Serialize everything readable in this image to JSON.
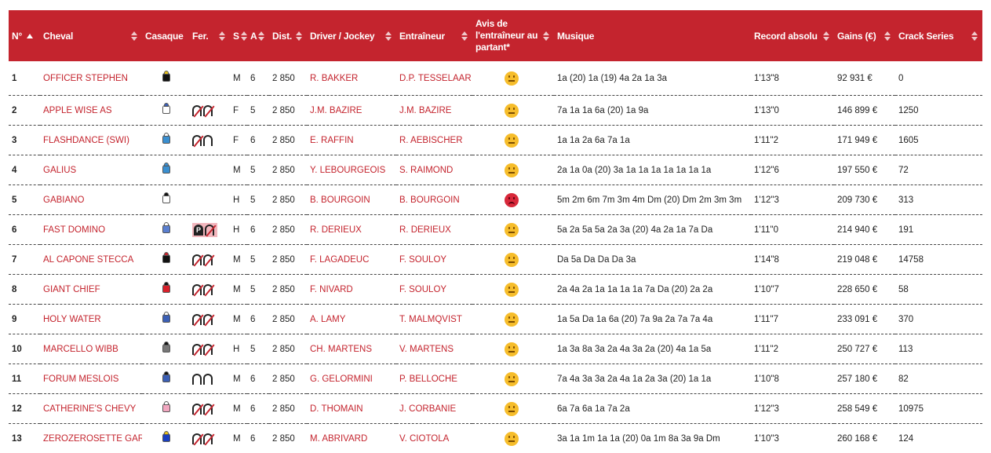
{
  "headers": {
    "num": "N°",
    "cheval": "Cheval",
    "casaque": "Casaque",
    "fer": "Fer.",
    "s": "S",
    "a": "A",
    "dist": "Dist.",
    "driver": "Driver / Jockey",
    "entraineur": "Entraîneur",
    "avis": "Avis de l'entraîneur au partant*",
    "musique": "Musique",
    "record": "Record absolu",
    "gains": "Gains (€)",
    "crack": "Crack Series"
  },
  "colors": {
    "accent": "#c4242e",
    "smiley_neutral": "#f6bd2b",
    "smiley_sad": "#d8283a"
  },
  "rows": [
    {
      "num": "1",
      "cheval": "OFFICER STEPHEN",
      "jersey": {
        "body": "#111111",
        "cap": "#e8c21a"
      },
      "fer": "none",
      "s": "M",
      "a": "6",
      "dist": "2 850",
      "driver": "R. BAKKER",
      "entraineur": "D.P. TESSELAAR",
      "avis": "neutral",
      "musique": "1a (20) 1a (19) 4a 2a 1a 3a",
      "record": "1'13\"8",
      "gains": "92 931 €",
      "crack": "0"
    },
    {
      "num": "2",
      "cheval": "APPLE WISE AS",
      "jersey": {
        "body": "#ffffff",
        "cap": "#3b5fb5"
      },
      "fer": "xx",
      "s": "F",
      "a": "5",
      "dist": "2 850",
      "driver": "J.M. BAZIRE",
      "entraineur": "J.M. BAZIRE",
      "avis": "neutral",
      "musique": "7a 1a 1a 6a (20) 1a 9a",
      "record": "1'13\"0",
      "gains": "146 899 €",
      "crack": "1250"
    },
    {
      "num": "3",
      "cheval": "FLASHDANCE (SWI)",
      "jersey": {
        "body": "#3a8fd0",
        "cap": "#ffffff"
      },
      "fer": "xo",
      "s": "F",
      "a": "6",
      "dist": "2 850",
      "driver": "E. RAFFIN",
      "entraineur": "R. AEBISCHER",
      "avis": "neutral",
      "musique": "1a 1a 2a 6a 7a 1a",
      "record": "1'11\"2",
      "gains": "171 949 €",
      "crack": "1605"
    },
    {
      "num": "4",
      "cheval": "GALIUS",
      "jersey": {
        "body": "#3a8fd0",
        "cap": "#3a8fd0"
      },
      "fer": "none",
      "s": "M",
      "a": "5",
      "dist": "2 850",
      "driver": "Y. LEBOURGEOIS",
      "entraineur": "S. RAIMOND",
      "avis": "neutral",
      "musique": "2a 1a 0a (20) 3a 1a 1a 1a 1a 1a 1a 1a",
      "record": "1'12\"6",
      "gains": "197 550 €",
      "crack": "72"
    },
    {
      "num": "5",
      "cheval": "GABIANO",
      "jersey": {
        "body": "#ffffff",
        "cap": "#111111"
      },
      "fer": "none",
      "s": "H",
      "a": "5",
      "dist": "2 850",
      "driver": "B. BOURGOIN",
      "entraineur": "B. BOURGOIN",
      "avis": "sad",
      "musique": "5m 2m 6m 7m 3m 4m Dm (20) Dm 2m 3m 3m",
      "record": "1'12\"3",
      "gains": "209 730 €",
      "crack": "313"
    },
    {
      "num": "6",
      "cheval": "FAST DOMINO",
      "jersey": {
        "body": "#5a7fd0",
        "cap": "#ffffff"
      },
      "fer": "p",
      "s": "H",
      "a": "6",
      "dist": "2 850",
      "driver": "R. DERIEUX",
      "entraineur": "R. DERIEUX",
      "avis": "neutral",
      "musique": "5a 2a 5a 5a 2a 3a (20) 4a 2a 1a 7a Da",
      "record": "1'11\"0",
      "gains": "214 940 €",
      "crack": "191"
    },
    {
      "num": "7",
      "cheval": "AL CAPONE STECCA",
      "jersey": {
        "body": "#111111",
        "cap": "#c4242e"
      },
      "fer": "xx",
      "s": "M",
      "a": "5",
      "dist": "2 850",
      "driver": "F. LAGADEUC",
      "entraineur": "F. SOULOY",
      "avis": "neutral",
      "musique": "Da 5a Da Da Da 3a",
      "record": "1'14\"8",
      "gains": "219 048 €",
      "crack": "14758"
    },
    {
      "num": "8",
      "cheval": "GIANT CHIEF",
      "jersey": {
        "body": "#d8202a",
        "cap": "#111111"
      },
      "fer": "xx",
      "s": "M",
      "a": "5",
      "dist": "2 850",
      "driver": "F. NIVARD",
      "entraineur": "F. SOULOY",
      "avis": "neutral",
      "musique": "2a 4a 2a 1a 1a 1a 1a 7a Da (20) 2a 2a",
      "record": "1'10\"7",
      "gains": "228 650 €",
      "crack": "58"
    },
    {
      "num": "9",
      "cheval": "HOLY WATER",
      "jersey": {
        "body": "#3b5fb5",
        "cap": "#ffffff"
      },
      "fer": "xx",
      "s": "M",
      "a": "6",
      "dist": "2 850",
      "driver": "A. LAMY",
      "entraineur": "T. MALMQVIST",
      "avis": "neutral",
      "musique": "1a 5a Da 1a 6a (20) 7a 9a 2a 7a 7a 4a",
      "record": "1'11\"7",
      "gains": "233 091 €",
      "crack": "370"
    },
    {
      "num": "10",
      "cheval": "MARCELLO WIBB",
      "jersey": {
        "body": "#777777",
        "cap": "#111111"
      },
      "fer": "xx",
      "s": "H",
      "a": "5",
      "dist": "2 850",
      "driver": "CH. MARTENS",
      "entraineur": "V. MARTENS",
      "avis": "neutral",
      "musique": "1a 3a 8a 3a 2a 4a 3a 2a (20) 4a 1a 5a",
      "record": "1'11\"2",
      "gains": "250 727 €",
      "crack": "113"
    },
    {
      "num": "11",
      "cheval": "FORUM MESLOIS",
      "jersey": {
        "body": "#3b5fb5",
        "cap": "#111111"
      },
      "fer": "oo",
      "s": "M",
      "a": "6",
      "dist": "2 850",
      "driver": "G. GELORMINI",
      "entraineur": "P. BELLOCHE",
      "avis": "neutral",
      "musique": "7a 4a 3a 3a 2a 4a 1a 2a 3a (20) 1a 1a",
      "record": "1'10\"8",
      "gains": "257 180 €",
      "crack": "82"
    },
    {
      "num": "12",
      "cheval": "CATHERINE'S CHEVY",
      "jersey": {
        "body": "#f2a7c0",
        "cap": "#ffffff"
      },
      "fer": "xx",
      "s": "M",
      "a": "6",
      "dist": "2 850",
      "driver": "D. THOMAIN",
      "entraineur": "J. CORBANIE",
      "avis": "neutral",
      "musique": "6a 7a 6a 1a 7a 2a",
      "record": "1'12\"3",
      "gains": "258 549 €",
      "crack": "10975"
    },
    {
      "num": "13",
      "cheval": "ZEROZEROSETTE GAR",
      "jersey": {
        "body": "#1a3fc0",
        "cap": "#e8c21a"
      },
      "fer": "xx",
      "s": "M",
      "a": "6",
      "dist": "2 850",
      "driver": "M. ABRIVARD",
      "entraineur": "V. CIOTOLA",
      "avis": "neutral",
      "musique": "3a 1a 1m 1a 1a (20) 0a 1m 8a 3a 9a Dm",
      "record": "1'10\"3",
      "gains": "260 168 €",
      "crack": "124"
    }
  ]
}
